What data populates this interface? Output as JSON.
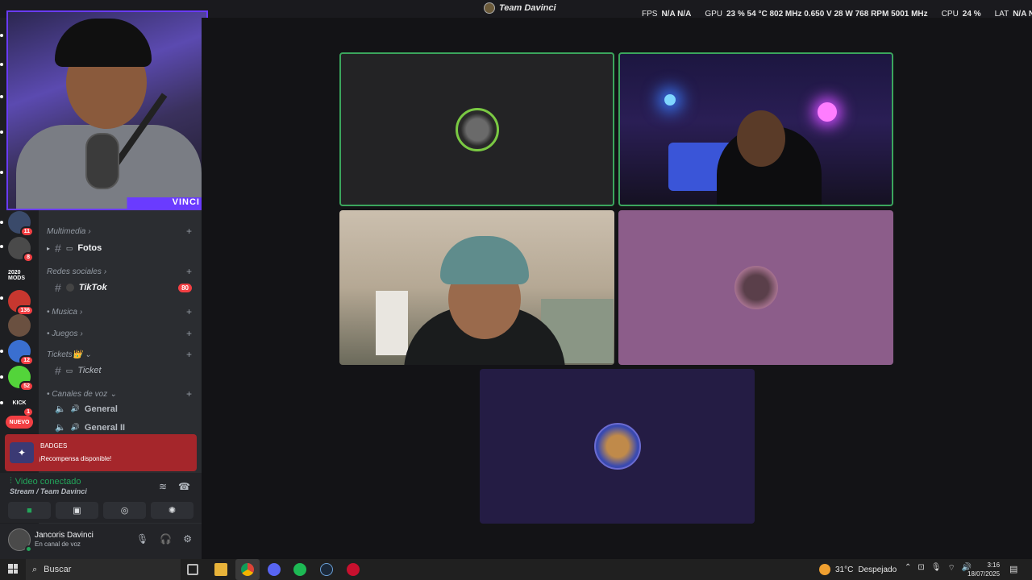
{
  "window": {
    "title": "Team Davinci"
  },
  "overlay": {
    "fps_label": "FPS",
    "fps_values": "N/A  N/A",
    "gpu_label": "GPU",
    "gpu_values": "23 %  54 °C  802 MHz  0.650 V  28 W  768 RPM  5001 MHz",
    "cpu_label": "CPU",
    "cpu_value": "24 %",
    "lat_label": "LAT",
    "lat_values": "N/A  N/A"
  },
  "webcam": {
    "watermark": "VINCI",
    "accent_color": "#6a3bff"
  },
  "servers": [
    {
      "label": "",
      "badge": "11",
      "color": "#3a4a6a"
    },
    {
      "label": "",
      "badge": "8",
      "color": "#4a4a4a"
    },
    {
      "label": "2020 MODS",
      "badge": "",
      "color": "#1e1f22"
    },
    {
      "label": "",
      "badge": "136",
      "color": "#c7372f"
    },
    {
      "label": "",
      "badge": "",
      "color": "#6a5040"
    },
    {
      "label": "",
      "badge": "12",
      "color": "#3a6fd0"
    },
    {
      "label": "",
      "badge": "52",
      "color": "#53d43a"
    },
    {
      "label": "KICK",
      "badge": "1",
      "color": "#1e1f22"
    },
    {
      "label": "NUEVO",
      "badge": "",
      "color": "#f23f43"
    }
  ],
  "channels": {
    "categories": [
      {
        "label": "Multimedia",
        "chevron": "›"
      },
      {
        "label": "Redes sociales",
        "chevron": "›"
      },
      {
        "label": "• Musica",
        "chevron": "›"
      },
      {
        "label": "• Juegos",
        "chevron": "›"
      },
      {
        "label": "Tickets👑",
        "chevron": "⌄"
      },
      {
        "label": "• Canales de voz",
        "chevron": "⌄"
      }
    ],
    "items": [
      {
        "prefix": "▸",
        "name": "Fotos",
        "badge": ""
      },
      {
        "prefix": "",
        "name": "TikTok",
        "badge": "80"
      },
      {
        "prefix": "",
        "name": "Ticket",
        "badge": ""
      },
      {
        "prefix": "",
        "name": "General",
        "badge": ""
      },
      {
        "prefix": "",
        "name": "General II",
        "badge": ""
      }
    ]
  },
  "reward": {
    "title": "BADGES",
    "subtitle": "¡Recompensa disponible!"
  },
  "voice": {
    "status": "Video conectado",
    "channel": "Stream / Team Davinci"
  },
  "user": {
    "name": "Jancoris Davinci",
    "status": "En canal de voz"
  },
  "taskbar": {
    "search_label": "Buscar",
    "weather_temp": "31°C",
    "weather_text": "Despejado",
    "time": "3:16",
    "date": "18/07/2025"
  }
}
